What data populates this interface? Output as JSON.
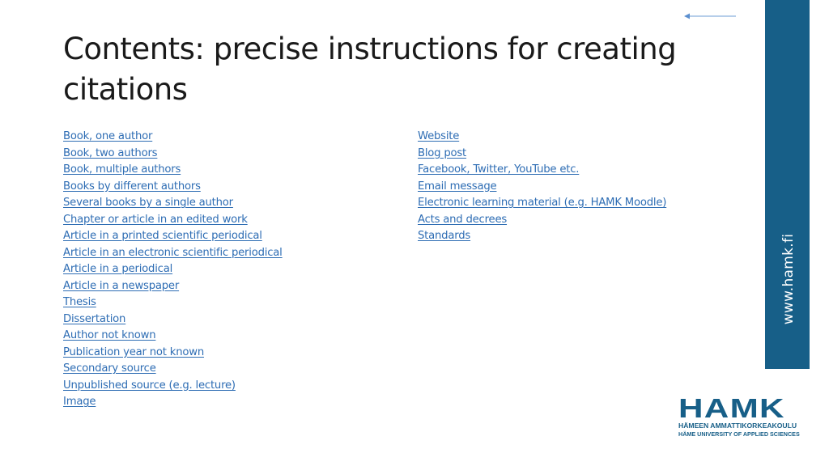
{
  "slide": {
    "title": "Contents: precise instructions for creating citations",
    "left_links": [
      "Book, one author",
      "Book, two authors",
      "Book, multiple authors",
      "Books by different authors",
      "Several books by a single author",
      "Chapter or article in an edited work",
      "Article in a printed scientific periodical",
      "Article in an electronic scientific periodical",
      "Article in a periodical",
      "Article in a newspaper",
      "Thesis",
      "Dissertation",
      "Author not known",
      "Publication year not known",
      "Secondary source",
      "Unpublished source (e.g. lecture)",
      "Image"
    ],
    "right_links": [
      "Website",
      "Blog post",
      "Facebook, Twitter, YouTube etc.",
      "Email message",
      "Electronic learning material (e.g. HAMK Moodle)",
      "Acts and decrees",
      "Standards"
    ],
    "side_bar_text": "www.hamk.fi",
    "back_arrow_icon": "arrow-left-icon",
    "logo": {
      "main": "HAMK",
      "line1": "HÄMEEN AMMATTIKORKEAKOULU",
      "line2": "HÄME UNIVERSITY OF APPLIED SCIENCES"
    }
  },
  "colors": {
    "link": "#2e6db4",
    "brand": "#175f88",
    "title": "#1a1a1a",
    "arrow": "#7aa6d6"
  }
}
